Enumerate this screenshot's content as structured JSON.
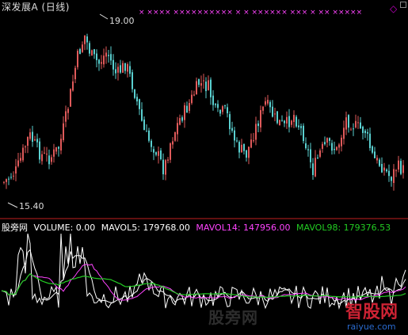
{
  "window": {
    "title": "深发展A (日线)",
    "corner_marker": "◇"
  },
  "price_panel": {
    "high_label": "19.00",
    "low_label": "15.40",
    "signal_marks": "× ×××× ×××××××××× × × ×××××× ××× × ×× ×××××"
  },
  "volume_panel": {
    "site_label": "股旁网",
    "volume": "VOLUME: 0.00",
    "mavol5": "MAVOL5: 179768.00",
    "mavol14": "MAVOL14: 147956.00",
    "mavol98": "MAVOL98: 179376.53",
    "colors": {
      "volume": "#ffffff",
      "mavol5": "#ffffff",
      "mavol14": "#ff44ff",
      "mavol98": "#22cc22"
    }
  },
  "watermark": {
    "text": "股旁网",
    "logo": "智股网",
    "url": "raiyue.com"
  },
  "colors": {
    "up": "#e05a5a",
    "down": "#5ad0d0",
    "signal": "#ff44ff",
    "separator": "#c02020"
  }
}
